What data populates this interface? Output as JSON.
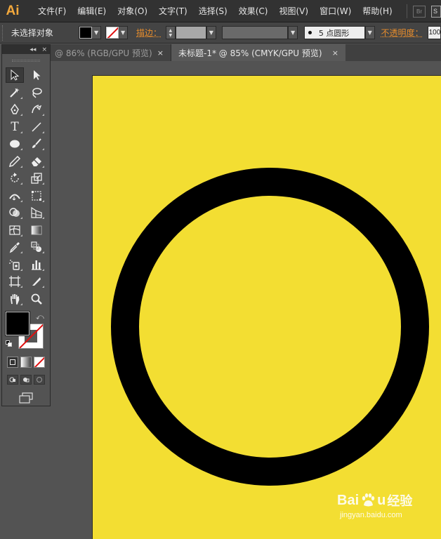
{
  "app": {
    "logo": "Ai"
  },
  "menu": {
    "items": [
      "文件(F)",
      "编辑(E)",
      "对象(O)",
      "文字(T)",
      "选择(S)",
      "效果(C)",
      "视图(V)",
      "窗口(W)",
      "帮助(H)"
    ],
    "bridge": "Br",
    "stock": "S"
  },
  "control_bar": {
    "selection": "未选择对象",
    "fill_color": "#000000",
    "stroke_label": "描边",
    "stroke_colon": "：",
    "brush": "5 点圆形",
    "opacity_label": "不透明度",
    "opacity_colon": "：",
    "opacity_value": "100"
  },
  "tabs": [
    {
      "label": "@ 86% (RGB/GPU 预览)",
      "close": "×",
      "active": false
    },
    {
      "label": "未标题-1* @ 85% (CMYK/GPU 预览)",
      "close": "×",
      "active": true
    }
  ],
  "toolbox": {
    "header_collapse": "◂◂",
    "header_close": "×",
    "type_tool_glyph": "T"
  },
  "artboard": {
    "background": "#f3de32",
    "shape": "ring",
    "ring_color": "#000000"
  },
  "watermark": {
    "brand_a": "Bai",
    "brand_b": "u",
    "cn": "经验",
    "url": "jingyan.baidu.com"
  }
}
